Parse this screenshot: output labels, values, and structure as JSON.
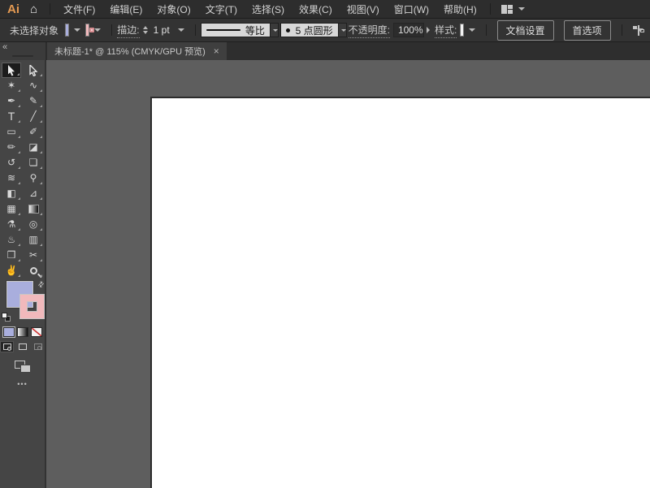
{
  "menubar": {
    "logo": "Ai",
    "items": [
      "文件(F)",
      "编辑(E)",
      "对象(O)",
      "文字(T)",
      "选择(S)",
      "效果(C)",
      "视图(V)",
      "窗口(W)",
      "帮助(H)"
    ]
  },
  "controlbar": {
    "status": "未选择对象",
    "fill_color": "#a9aedd",
    "stroke_color": "#f1b9bc",
    "stroke_label": "描边:",
    "stroke_value": "1 pt",
    "profile_label": "等比",
    "brush_value": "5 点圆形",
    "opacity_label": "不透明度:",
    "opacity_value": "100%",
    "style_label": "样式:",
    "document_setup_label": "文档设置",
    "preferences_label": "首选项"
  },
  "tabbar": {
    "title": "未标题-1* @ 115% (CMYK/GPU 预览)",
    "close": "×"
  },
  "toolbar": {
    "collapse": "«",
    "more": "•••",
    "tools": [
      {
        "name": "selection-tool",
        "selected": true
      },
      {
        "name": "direct-selection-tool"
      },
      {
        "name": "magic-wand-tool",
        "glyph": "✶"
      },
      {
        "name": "lasso-tool",
        "glyph": "∿"
      },
      {
        "name": "pen-tool",
        "glyph": "✒"
      },
      {
        "name": "curvature-tool",
        "glyph": "✎"
      },
      {
        "name": "type-tool",
        "glyph": "T"
      },
      {
        "name": "line-segment-tool",
        "glyph": "╱"
      },
      {
        "name": "rectangle-tool",
        "glyph": "▭"
      },
      {
        "name": "paintbrush-tool",
        "glyph": "✐"
      },
      {
        "name": "shaper-tool",
        "glyph": "✏"
      },
      {
        "name": "eraser-tool",
        "glyph": "◪"
      },
      {
        "name": "rotate-tool",
        "glyph": "↺"
      },
      {
        "name": "scale-tool",
        "glyph": "❏"
      },
      {
        "name": "width-tool",
        "glyph": "≋"
      },
      {
        "name": "free-transform-tool",
        "glyph": "⚲"
      },
      {
        "name": "shape-builder-tool",
        "glyph": "◧"
      },
      {
        "name": "perspective-grid-tool",
        "glyph": "⊿"
      },
      {
        "name": "mesh-tool",
        "glyph": "▦"
      },
      {
        "name": "gradient-tool"
      },
      {
        "name": "eyedropper-tool",
        "glyph": "⚗"
      },
      {
        "name": "blend-tool",
        "glyph": "◎"
      },
      {
        "name": "symbol-sprayer-tool",
        "glyph": "♨"
      },
      {
        "name": "column-graph-tool",
        "glyph": "▥"
      },
      {
        "name": "artboard-tool",
        "glyph": "❒"
      },
      {
        "name": "slice-tool",
        "glyph": "✂"
      },
      {
        "name": "hand-tool",
        "glyph": "✌"
      },
      {
        "name": "zoom-tool"
      }
    ]
  },
  "icons": {
    "home": "⌂",
    "swap": "⇄"
  }
}
